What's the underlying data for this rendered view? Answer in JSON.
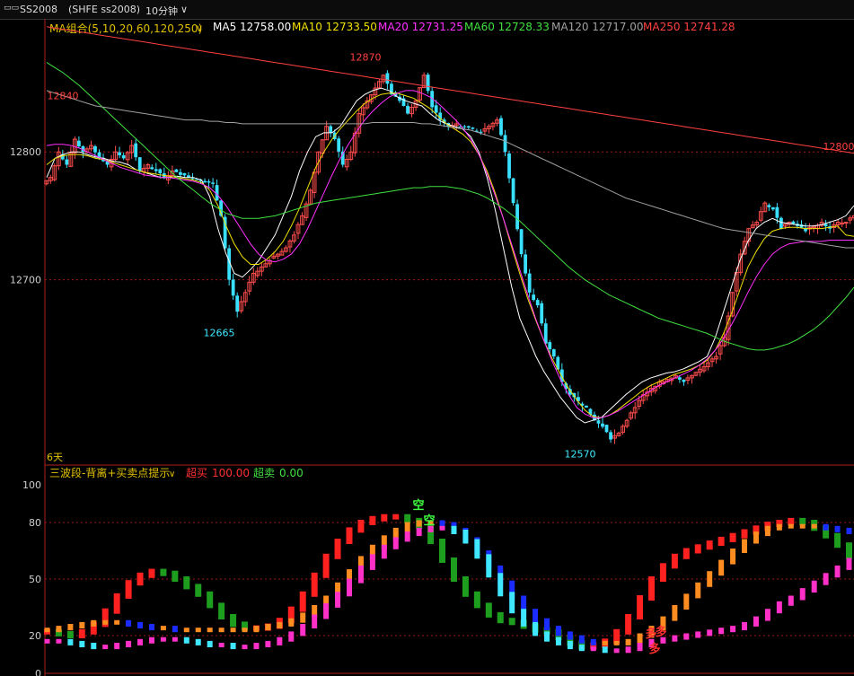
{
  "toolbar": {
    "symbol": "SS2008",
    "exchange": "(SHFE ss2008)",
    "period": "10分钟",
    "period_arrow": "∨"
  },
  "ma_legend": {
    "group": "MA组合(5,10,20,60,120,250)",
    "items": [
      {
        "label": "MA5",
        "value": "12758.00",
        "color": "#ffffff"
      },
      {
        "label": "MA10",
        "value": "12733.50",
        "color": "#f0e000"
      },
      {
        "label": "MA20",
        "value": "12731.25",
        "color": "#ff30ff"
      },
      {
        "label": "MA60",
        "value": "12728.33",
        "color": "#40e040"
      },
      {
        "label": "MA120",
        "value": "12717.00",
        "color": "#a0a0a0"
      },
      {
        "label": "MA250",
        "value": "12741.28",
        "color": "#ff4040"
      }
    ]
  },
  "indicator_legend": {
    "name": "三波段-背离+买卖点提示",
    "overbought_label": "超买",
    "overbought_value": "100.00",
    "oversold_label": "超卖",
    "oversold_value": "0.00"
  },
  "chart_data": [
    {
      "type": "candlestick",
      "y_ticks": [
        12800,
        12700
      ],
      "ylim": [
        12555,
        12895
      ],
      "x_label_bottom_left": "6天",
      "annotations": [
        {
          "text": "12840",
          "value": 12840,
          "color": "#ff4040"
        },
        {
          "text": "12870",
          "value": 12870,
          "color": "#ff4040"
        },
        {
          "text": "12800",
          "value": 12800,
          "color": "#ff4040"
        },
        {
          "text": "12665",
          "value": 12665,
          "color": "#40e8ff"
        },
        {
          "text": "12570",
          "value": 12570,
          "color": "#40e8ff"
        }
      ],
      "close_path": [
        12780,
        12800,
        12790,
        12810,
        12800,
        12805,
        12795,
        12790,
        12800,
        12795,
        12805,
        12785,
        12790,
        12785,
        12780,
        12785,
        12782,
        12780,
        12778,
        12776,
        12775,
        12750,
        12700,
        12675,
        12690,
        12705,
        12710,
        12715,
        12720,
        12725,
        12735,
        12750,
        12770,
        12800,
        12820,
        12810,
        12790,
        12800,
        12830,
        12840,
        12850,
        12860,
        12845,
        12840,
        12830,
        12840,
        12860,
        12835,
        12825,
        12820,
        12822,
        12820,
        12818,
        12815,
        12820,
        12825,
        12800,
        12760,
        12720,
        12690,
        12680,
        12650,
        12640,
        12620,
        12610,
        12605,
        12600,
        12590,
        12585,
        12575,
        12580,
        12590,
        12600,
        12610,
        12615,
        12620,
        12622,
        12625,
        12620,
        12625,
        12630,
        12635,
        12640,
        12655,
        12690,
        12720,
        12740,
        12745,
        12760,
        12755,
        12740,
        12745,
        12742,
        12738,
        12742,
        12745,
        12740,
        12745,
        12745,
        12750
      ],
      "series": [
        {
          "name": "MA5",
          "color": "#ffffff",
          "values": [
            12780,
            12795,
            12798,
            12800,
            12800,
            12798,
            12796,
            12795,
            12793,
            12792,
            12790,
            12786,
            12784,
            12782,
            12780,
            12780,
            12781,
            12780,
            12780,
            12778,
            12765,
            12740,
            12720,
            12705,
            12702,
            12708,
            12715,
            12725,
            12735,
            12750,
            12765,
            12785,
            12800,
            12812,
            12815,
            12815,
            12820,
            12830,
            12840,
            12845,
            12848,
            12850,
            12848,
            12843,
            12840,
            12838,
            12836,
            12830,
            12825,
            12822,
            12820,
            12818,
            12812,
            12800,
            12780,
            12755,
            12725,
            12695,
            12670,
            12655,
            12640,
            12628,
            12618,
            12608,
            12600,
            12592,
            12588,
            12590,
            12592,
            12598,
            12604,
            12610,
            12615,
            12620,
            12623,
            12625,
            12627,
            12628,
            12630,
            12633,
            12636,
            12640,
            12655,
            12675,
            12695,
            12715,
            12730,
            12740,
            12745,
            12748,
            12745,
            12744,
            12743,
            12742,
            12742,
            12743,
            12745,
            12747,
            12750,
            12758
          ]
        },
        {
          "name": "MA10",
          "color": "#f0e000",
          "values": [
            12790,
            12795,
            12797,
            12798,
            12798,
            12797,
            12795,
            12794,
            12792,
            12790,
            12788,
            12786,
            12784,
            12783,
            12782,
            12781,
            12780,
            12779,
            12778,
            12776,
            12770,
            12758,
            12742,
            12728,
            12718,
            12712,
            12712,
            12716,
            12722,
            12730,
            12742,
            12756,
            12772,
            12788,
            12800,
            12810,
            12818,
            12825,
            12832,
            12838,
            12842,
            12845,
            12846,
            12846,
            12844,
            12842,
            12838,
            12834,
            12828,
            12822,
            12818,
            12814,
            12808,
            12798,
            12785,
            12768,
            12748,
            12726,
            12705,
            12685,
            12668,
            12652,
            12638,
            12626,
            12615,
            12606,
            12598,
            12593,
            12592,
            12594,
            12598,
            12603,
            12608,
            12613,
            12617,
            12620,
            12623,
            12626,
            12628,
            12630,
            12633,
            12637,
            12645,
            12658,
            12674,
            12692,
            12710,
            12722,
            12732,
            12738,
            12740,
            12741,
            12741,
            12740,
            12740,
            12740,
            12741,
            12742,
            12735,
            12734
          ]
        },
        {
          "name": "MA20",
          "color": "#ff30ff",
          "values": [
            12805,
            12806,
            12806,
            12805,
            12803,
            12800,
            12797,
            12794,
            12791,
            12788,
            12786,
            12784,
            12782,
            12781,
            12780,
            12780,
            12779,
            12778,
            12777,
            12775,
            12772,
            12766,
            12758,
            12748,
            12738,
            12728,
            12720,
            12715,
            12714,
            12716,
            12720,
            12728,
            12740,
            12754,
            12768,
            12782,
            12795,
            12806,
            12816,
            12825,
            12832,
            12838,
            12843,
            12846,
            12848,
            12848,
            12846,
            12843,
            12838,
            12832,
            12826,
            12819,
            12810,
            12798,
            12783,
            12766,
            12748,
            12728,
            12708,
            12688,
            12669,
            12652,
            12636,
            12622,
            12610,
            12600,
            12595,
            12592,
            12592,
            12594,
            12597,
            12601,
            12605,
            12609,
            12613,
            12617,
            12620,
            12623,
            12626,
            12629,
            12633,
            12638,
            12645,
            12654,
            12665,
            12677,
            12690,
            12702,
            12712,
            12720,
            12725,
            12728,
            12729,
            12730,
            12730,
            12730,
            12731,
            12731,
            12731,
            12731
          ]
        },
        {
          "name": "MA60",
          "color": "#40e040",
          "values": [
            12870,
            12866,
            12862,
            12857,
            12852,
            12846,
            12840,
            12834,
            12828,
            12822,
            12816,
            12810,
            12804,
            12798,
            12792,
            12786,
            12780,
            12775,
            12770,
            12765,
            12760,
            12756,
            12752,
            12750,
            12748,
            12748,
            12748,
            12749,
            12750,
            12752,
            12754,
            12756,
            12758,
            12760,
            12761,
            12762,
            12763,
            12764,
            12765,
            12766,
            12767,
            12768,
            12769,
            12770,
            12771,
            12772,
            12772,
            12773,
            12773,
            12773,
            12772,
            12771,
            12769,
            12767,
            12764,
            12760,
            12756,
            12751,
            12746,
            12740,
            12734,
            12728,
            12722,
            12716,
            12710,
            12705,
            12700,
            12696,
            12692,
            12688,
            12685,
            12682,
            12679,
            12676,
            12673,
            12670,
            12668,
            12666,
            12664,
            12662,
            12660,
            12658,
            12655,
            12652,
            12650,
            12648,
            12646,
            12645,
            12645,
            12646,
            12648,
            12650,
            12653,
            12657,
            12661,
            12666,
            12672,
            12679,
            12686,
            12694
          ]
        },
        {
          "name": "MA120",
          "color": "#a0a0a0",
          "values": [
            12848,
            12846,
            12844,
            12842,
            12840,
            12838,
            12836,
            12835,
            12834,
            12833,
            12832,
            12831,
            12830,
            12829,
            12828,
            12827,
            12826,
            12825,
            12825,
            12825,
            12824,
            12824,
            12823,
            12823,
            12822,
            12822,
            12822,
            12822,
            12822,
            12822,
            12822,
            12822,
            12822,
            12822,
            12822,
            12822,
            12822,
            12822,
            12822,
            12822,
            12823,
            12823,
            12823,
            12823,
            12823,
            12823,
            12822,
            12822,
            12821,
            12820,
            12819,
            12818,
            12817,
            12815,
            12813,
            12811,
            12809,
            12806,
            12803,
            12800,
            12797,
            12794,
            12791,
            12788,
            12785,
            12782,
            12779,
            12776,
            12773,
            12770,
            12767,
            12764,
            12762,
            12760,
            12758,
            12756,
            12754,
            12752,
            12750,
            12748,
            12746,
            12744,
            12742,
            12740,
            12739,
            12738,
            12737,
            12736,
            12735,
            12734,
            12733,
            12732,
            12731,
            12730,
            12729,
            12728,
            12727,
            12726,
            12725,
            12725
          ]
        },
        {
          "name": "MA250",
          "color": "#ff4040",
          "values": [
            12898,
            12897,
            12896,
            12895,
            12894,
            12893,
            12892,
            12891,
            12890,
            12889,
            12888,
            12887,
            12886,
            12885,
            12884,
            12883,
            12882,
            12881,
            12880,
            12879,
            12878,
            12877,
            12876,
            12875,
            12874,
            12873,
            12872,
            12871,
            12870,
            12869,
            12868,
            12867,
            12866,
            12865,
            12864,
            12863,
            12862,
            12861,
            12860,
            12859,
            12858,
            12857,
            12856,
            12855,
            12854,
            12853,
            12852,
            12851,
            12850,
            12849,
            12848,
            12847,
            12846,
            12845,
            12844,
            12843,
            12842,
            12841,
            12840,
            12839,
            12838,
            12837,
            12836,
            12835,
            12834,
            12833,
            12832,
            12831,
            12830,
            12829,
            12828,
            12827,
            12826,
            12825,
            12824,
            12823,
            12822,
            12821,
            12820,
            12819,
            12818,
            12817,
            12816,
            12815,
            12814,
            12813,
            12812,
            12811,
            12810,
            12809,
            12808,
            12807,
            12806,
            12805,
            12804,
            12803,
            12802,
            12801,
            12800,
            12799
          ]
        }
      ]
    },
    {
      "type": "line",
      "y_ticks": [
        100,
        80,
        50,
        20,
        0
      ],
      "ylim": [
        0,
        100
      ],
      "annotations": [
        {
          "text": "空",
          "color": "#40ff40"
        },
        {
          "text": "空",
          "color": "#40ff40"
        },
        {
          "text": "多",
          "color": "#ff3030"
        },
        {
          "text": "多",
          "color": "#ff3030"
        },
        {
          "text": "多",
          "color": "#ff3030"
        }
      ],
      "series": [
        {
          "name": "fast",
          "values": [
            22,
            21,
            20,
            22,
            26,
            33,
            41,
            48,
            52,
            54,
            53,
            50,
            46,
            42,
            36,
            30,
            26,
            24,
            24,
            25,
            28,
            34,
            42,
            52,
            62,
            70,
            76,
            80,
            82,
            83,
            83,
            81,
            78,
            70,
            60,
            50,
            42,
            36,
            31,
            28,
            27,
            25,
            23,
            22,
            19,
            16,
            14,
            15,
            17,
            22,
            30,
            40,
            50,
            57,
            62,
            65,
            67,
            69,
            71,
            73,
            75,
            77,
            79,
            80,
            81,
            80,
            77,
            73,
            68,
            62
          ]
        },
        {
          "name": "mid",
          "values": [
            23,
            24,
            25,
            26,
            27,
            27,
            27,
            26,
            25,
            24,
            24,
            23,
            23,
            23,
            23,
            23,
            23,
            23,
            24,
            25,
            26,
            28,
            31,
            35,
            40,
            47,
            54,
            61,
            67,
            72,
            76,
            79,
            80,
            80,
            79,
            76,
            71,
            64,
            56,
            48,
            40,
            33,
            28,
            24,
            21,
            19,
            17,
            16,
            16,
            16,
            17,
            20,
            24,
            29,
            35,
            41,
            47,
            53,
            59,
            65,
            70,
            74,
            77,
            78,
            78,
            78,
            78,
            77,
            76,
            75
          ]
        },
        {
          "name": "slow",
          "values": [
            17,
            17,
            16,
            15,
            14,
            14,
            15,
            16,
            17,
            18,
            18,
            18,
            17,
            16,
            15,
            15,
            14,
            14,
            15,
            16,
            18,
            21,
            25,
            30,
            36,
            42,
            49,
            56,
            62,
            67,
            71,
            74,
            76,
            77,
            77,
            75,
            70,
            62,
            52,
            42,
            33,
            26,
            21,
            18,
            16,
            14,
            13,
            13,
            12,
            12,
            13,
            15,
            17,
            18,
            19,
            20,
            21,
            22,
            23,
            24,
            26,
            29,
            33,
            37,
            40,
            44,
            48,
            52,
            56,
            60
          ]
        }
      ]
    }
  ]
}
